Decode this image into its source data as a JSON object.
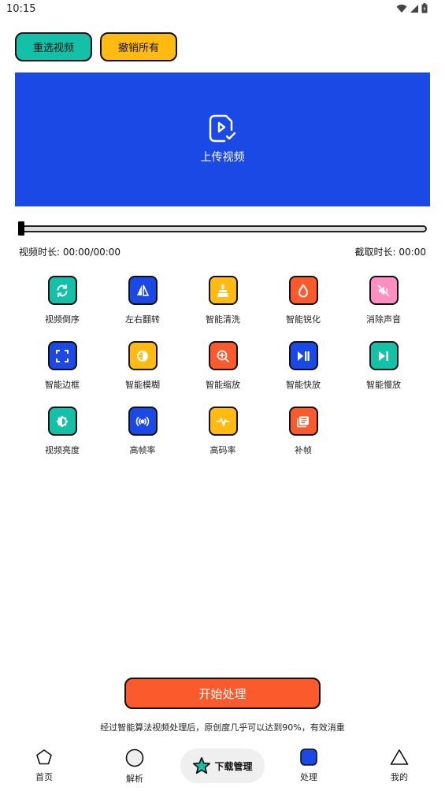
{
  "status_bar": {
    "time": "10:15"
  },
  "top_buttons": {
    "reselect": "重选视频",
    "undo_all": "撤销所有"
  },
  "upload": {
    "label": "上传视频"
  },
  "timeline": {
    "progress": 0,
    "duration_label": "视频时长: 00:00/00:00",
    "clip_label": "截取时长: 00:00"
  },
  "tools": [
    {
      "label": "视频倒序",
      "icon": "reverse-icon",
      "color": "#14c1a8"
    },
    {
      "label": "左右翻转",
      "icon": "flip-icon",
      "color": "#1a49e6"
    },
    {
      "label": "智能清洗",
      "icon": "clean-brush-icon",
      "color": "#ffbb12"
    },
    {
      "label": "智能锐化",
      "icon": "drop-icon",
      "color": "#fb5a2c"
    },
    {
      "label": "消除声音",
      "icon": "mute-icon",
      "color": "#ff8fc1"
    },
    {
      "label": "智能边框",
      "icon": "frame-corners-icon",
      "color": "#1a49e6"
    },
    {
      "label": "智能模糊",
      "icon": "blur-icon",
      "color": "#ffbb12"
    },
    {
      "label": "智能缩放",
      "icon": "zoom-in-icon",
      "color": "#fb5a2c"
    },
    {
      "label": "智能快放",
      "icon": "play-pause-icon",
      "color": "#1a49e6"
    },
    {
      "label": "智能慢放",
      "icon": "skip-next-icon",
      "color": "#14c1a8"
    },
    {
      "label": "视频亮度",
      "icon": "brightness-icon",
      "color": "#14c1a8"
    },
    {
      "label": "高帧率",
      "icon": "broadcast-icon",
      "color": "#1a49e6"
    },
    {
      "label": "高码率",
      "icon": "waveform-icon",
      "color": "#ffbb12"
    },
    {
      "label": "补帧",
      "icon": "frames-icon",
      "color": "#fb5a2c"
    }
  ],
  "start_button": "开始处理",
  "notice": "经过智能算法视频处理后，原创度几乎可以达到90%，有效消重",
  "nav": {
    "home": "首页",
    "parse": "解析",
    "download": "下载管理",
    "process": "处理",
    "mine": "我的"
  },
  "colors": {
    "blue": "#1a49e6",
    "teal": "#14c1a8",
    "yellow": "#ffbb12",
    "orange": "#fb5a2c",
    "pink": "#ff8fc1"
  }
}
